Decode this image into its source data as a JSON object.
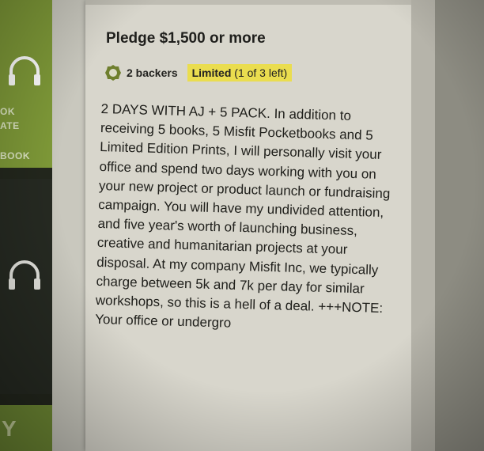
{
  "sidebar": {
    "tile_top_lines": [
      "OK",
      "ATE",
      "BOOK"
    ],
    "tile_bottom_letter": "Y"
  },
  "reward": {
    "title": "Pledge $1,500 or more",
    "backers": "2 backers",
    "limited_label": "Limited",
    "limited_detail": "(1 of 3 left)",
    "description": "2 DAYS WITH AJ + 5 PACK. In addition to receiving 5 books, 5 Misfit Pocketbooks and 5 Limited Edition Prints, I will personally visit your office and spend two days working with you on your new project or product launch or fundraising campaign. You will have my undivided attention, and five year's worth of launching business, creative and humanitarian projects at your disposal. At my company Misfit Inc, we typically charge between 5k and 7k per day for similar workshops, so this is a hell of a deal. +++NOTE: Your office or undergro"
  },
  "colors": {
    "tile_green": "#7f9a38",
    "limited_highlight": "#eadd4f",
    "card_background": "#d8d6cc"
  }
}
